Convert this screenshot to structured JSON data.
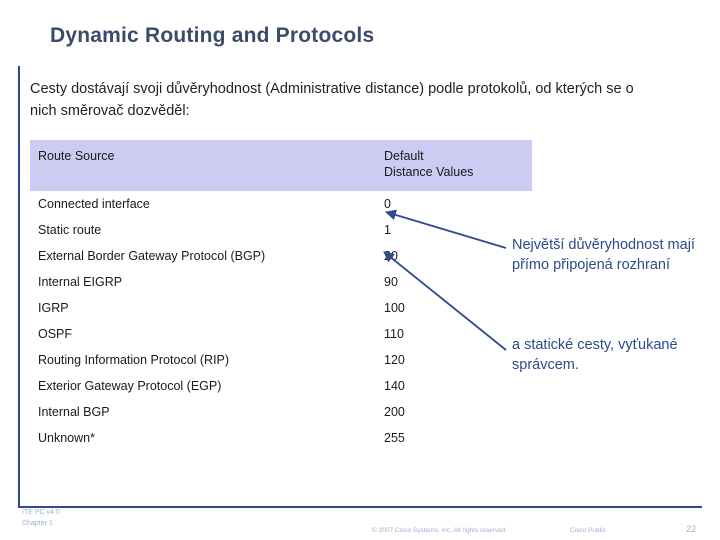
{
  "slide": {
    "title": "Dynamic Routing and Protocols",
    "intro": "Cesty dostávají svoji důvěryhodnost (Administrative distance) podle protokolů, od kterých se o nich směrovač dozvěděl:",
    "accent_color": "#2e4b8f",
    "title_color": "#3c4a6b",
    "header_fill": "#ccccf2"
  },
  "table": {
    "headers": {
      "source": "Route Source",
      "value_line1": "Default",
      "value_line2": "Distance Values"
    },
    "rows": [
      {
        "source": "Connected interface",
        "value": "0"
      },
      {
        "source": "Static route",
        "value": "1"
      },
      {
        "source": "External Border Gateway Protocol (BGP)",
        "value": "20"
      },
      {
        "source": "Internal EIGRP",
        "value": "90"
      },
      {
        "source": "IGRP",
        "value": "100"
      },
      {
        "source": "OSPF",
        "value": "110"
      },
      {
        "source": "Routing Information Protocol (RIP)",
        "value": "120"
      },
      {
        "source": "Exterior Gateway Protocol (EGP)",
        "value": "140"
      },
      {
        "source": "Internal BGP",
        "value": "200"
      },
      {
        "source": "Unknown*",
        "value": "255"
      }
    ]
  },
  "notes": {
    "note1": "Největší důvěryhodnost mají přímo připojená rozhraní",
    "note2": "a statické cesty, vyťukané správcem."
  },
  "footer": {
    "line1": "ITE PC v4.0",
    "line2": "Chapter 1",
    "copyright": "© 2007 Cisco Systems, Inc. All rights reserved.",
    "classification": "Cisco Public",
    "page": "22"
  }
}
